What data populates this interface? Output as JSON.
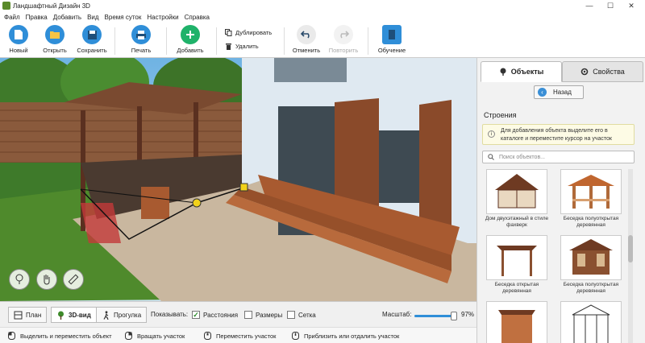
{
  "app": {
    "title": "Ландшафтный Дизайн 3D"
  },
  "window": {
    "minimize": "—",
    "maximize": "☐",
    "close": "✕"
  },
  "menu": [
    "Файл",
    "Правка",
    "Добавить",
    "Вид",
    "Время суток",
    "Настройки",
    "Справка"
  ],
  "toolbar": {
    "new": "Новый",
    "open": "Открыть",
    "save": "Сохранить",
    "print": "Печать",
    "add": "Добавить",
    "duplicate": "Дублировать",
    "delete": "Удалить",
    "undo": "Отменить",
    "redo": "Повторить",
    "learn": "Обучение"
  },
  "panel": {
    "tab_objects": "Объекты",
    "tab_properties": "Свойства",
    "back": "Назад",
    "section": "Строения",
    "hint": "Для добавления объекта выделите его в каталоге и переместите курсор на участок",
    "search_placeholder": "Поиск объектов...",
    "items": [
      {
        "caption": "Дом двухэтажный в стиле фахверк"
      },
      {
        "caption": "Беседка полуоткрытая деревянная"
      },
      {
        "caption": "Беседка открытая деревянная"
      },
      {
        "caption": "Беседка полуоткрытая деревянная"
      },
      {
        "caption": ""
      },
      {
        "caption": ""
      }
    ]
  },
  "bottom": {
    "plan": "План",
    "view3d": "3D-вид",
    "walk": "Прогулка",
    "show_label": "Показывать:",
    "distances": "Расстояния",
    "sizes": "Размеры",
    "grid": "Сетка",
    "scale_label": "Масштаб:",
    "scale_value": "97%",
    "scale_fraction": 0.97
  },
  "checks": {
    "distances": true,
    "sizes": false,
    "grid": false
  },
  "status": {
    "select": "Выделить и переместить объект",
    "rotate": "Вращать участок",
    "move": "Переместить участок",
    "zoom": "Приблизить или отдалить участок"
  },
  "colors": {
    "accent": "#2f8ed8",
    "add": "#1fb26a",
    "grass": "#4f8a2c",
    "paving": "#c9b79f",
    "wood": "#8a4a2a"
  },
  "icons": {
    "new": "new-file-icon",
    "open": "folder-icon",
    "save": "floppy-icon",
    "print": "printer-icon",
    "add": "plus-icon",
    "undo": "undo-icon",
    "redo": "redo-icon",
    "learn": "book-icon"
  }
}
